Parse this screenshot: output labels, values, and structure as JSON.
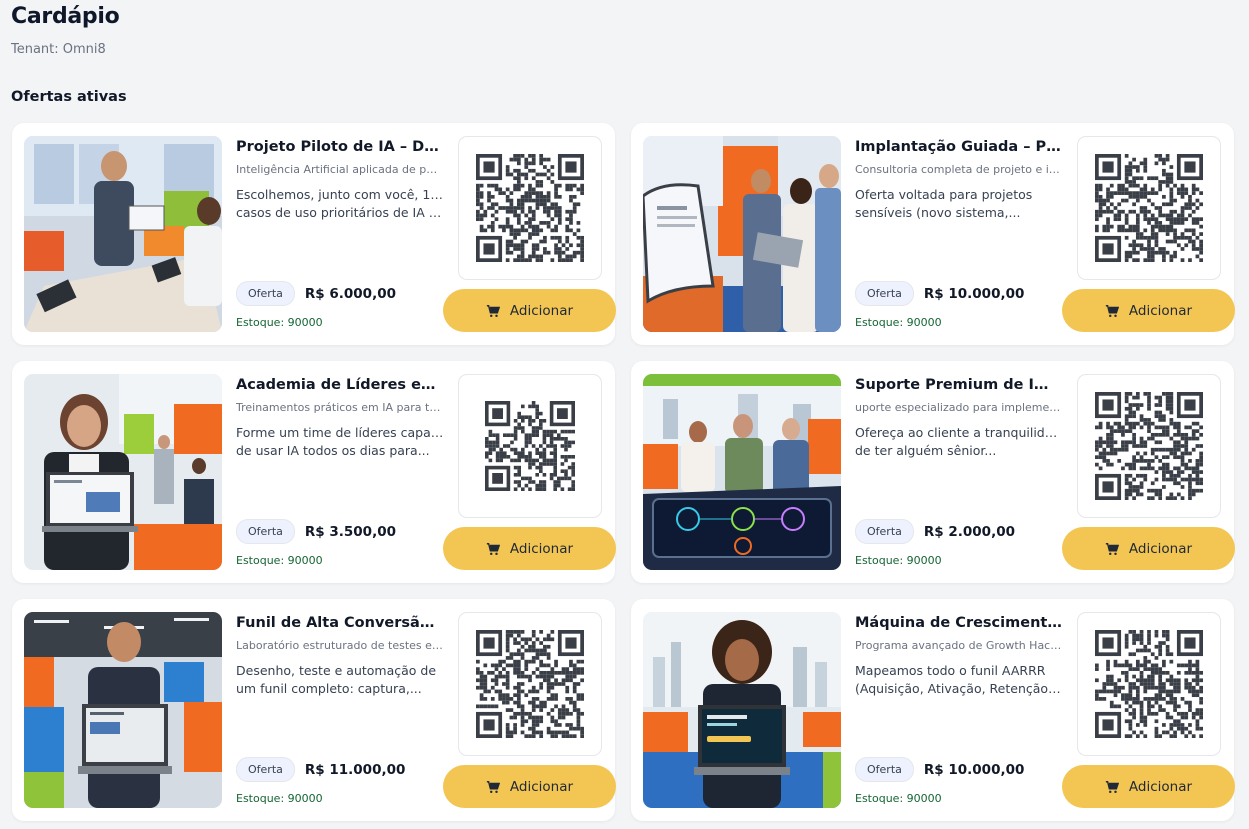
{
  "page": {
    "title": "Cardápio",
    "tenant": "Tenant: Omni8",
    "section_title": "Ofertas ativas"
  },
  "button_label": "Adicionar",
  "offers": [
    {
      "title": "Projeto Piloto de IA – Do ...",
      "subtitle": "Inteligência Artificial aplicada de pon...",
      "desc1": "Escolhemos, junto com você, 1 a 3",
      "desc2": "casos de uso prioritários de IA e...",
      "badge": "Oferta",
      "price": "R$ 6.000,00",
      "stock": "Estoque: 90000",
      "image": "office-meeting-photo"
    },
    {
      "title": "Implantação Guiada – Pro...",
      "subtitle": "Consultoria completa de projeto e im...",
      "desc1": "Oferta voltada para projetos",
      "desc2": "sensíveis (novo sistema,...",
      "badge": "Oferta",
      "price": "R$ 10.000,00",
      "stock": "Estoque: 90000",
      "image": "team-laptop-photo"
    },
    {
      "title": "Academia de Líderes em I...",
      "subtitle": "Treinamentos práticos em IA para tra...",
      "desc1": "Forme um time de líderes capazes",
      "desc2": "de usar IA todos os dias para...",
      "badge": "Oferta",
      "price": "R$ 3.500,00",
      "stock": "Estoque: 90000",
      "image": "woman-laptop-photo"
    },
    {
      "title": "Suporte Premium de Impl...",
      "subtitle": "uporte especializado para implement...",
      "desc1": "Ofereça ao cliente a tranquilidade",
      "desc2": "de ter alguém sênior...",
      "badge": "Oferta",
      "price": "R$ 2.000,00",
      "stock": "Estoque: 90000",
      "image": "interactive-table-photo"
    },
    {
      "title": "Funil de Alta Conversão c...",
      "subtitle": "Laboratório estruturado de testes e ex...",
      "desc1": "Desenho, teste e automação de",
      "desc2": "um funil completo: captura,...",
      "badge": "Oferta",
      "price": "R$ 11.000,00",
      "stock": "Estoque: 90000",
      "image": "man-laptop-photo"
    },
    {
      "title": "Máquina de Crescimento ...",
      "subtitle": "Programa avançado de Growth Hacki...",
      "desc1": "Mapeamos todo o funil AARRR",
      "desc2": "(Aquisição, Ativação, Retenção,...",
      "badge": "Oferta",
      "price": "R$ 10.000,00",
      "stock": "Estoque: 90000",
      "image": "woman-dashboard-photo"
    }
  ],
  "colors": {
    "background": "#f3f4f6",
    "button": "#f3c552",
    "stock_text": "#166534",
    "badge_bg": "#eef2ff"
  }
}
